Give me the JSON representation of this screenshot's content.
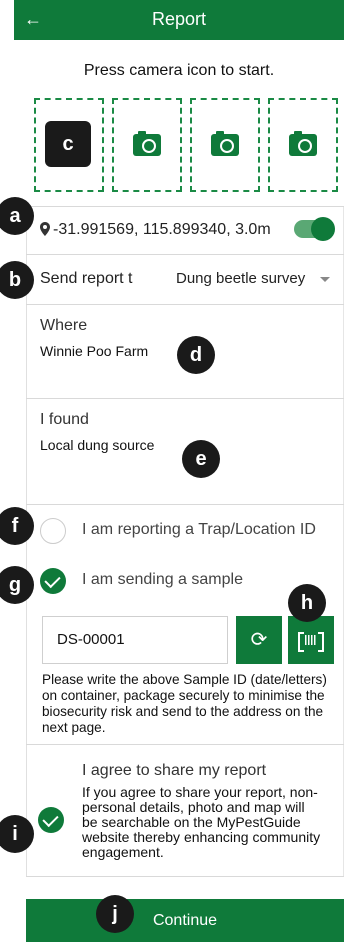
{
  "appbar": {
    "title": "Report",
    "back_icon": "arrow-left-icon"
  },
  "instruction": "Press camera icon to start.",
  "photos": {
    "slot_count": 4,
    "icon": "camera-icon"
  },
  "location": {
    "coords": "-31.991569, 115.899340, 3.0m",
    "gps_toggle_on": true,
    "icon": "map-pin-icon"
  },
  "send_report": {
    "label": "Send report t",
    "value": "Dung beetle survey"
  },
  "where": {
    "label": "Where",
    "value": "Winnie Poo Farm"
  },
  "found": {
    "label": "I found",
    "value": "Local dung source"
  },
  "trap": {
    "label": "I am reporting a Trap/Location ID",
    "checked": false
  },
  "sample": {
    "label": "I am sending a sample",
    "checked": true,
    "sample_id": "DS-00001"
  },
  "note": "Please write the above Sample ID (date/letters) on container, package securely to minimise the biosecurity risk and send to the address on the next page.",
  "agree": {
    "title": "I agree to share my report",
    "description": "If you agree to share your report, non-personal details, photo and map will be searchable on the MyPestGuide website thereby enhancing community engagement.",
    "checked": true
  },
  "continue_label": "Continue",
  "annotations": {
    "a": "a",
    "b": "b",
    "c": "c",
    "d": "d",
    "e": "e",
    "f": "f",
    "g": "g",
    "h": "h",
    "i": "i",
    "j": "j"
  },
  "colors": {
    "primary": "#0f7a3a",
    "badge": "#1a1a1a"
  }
}
